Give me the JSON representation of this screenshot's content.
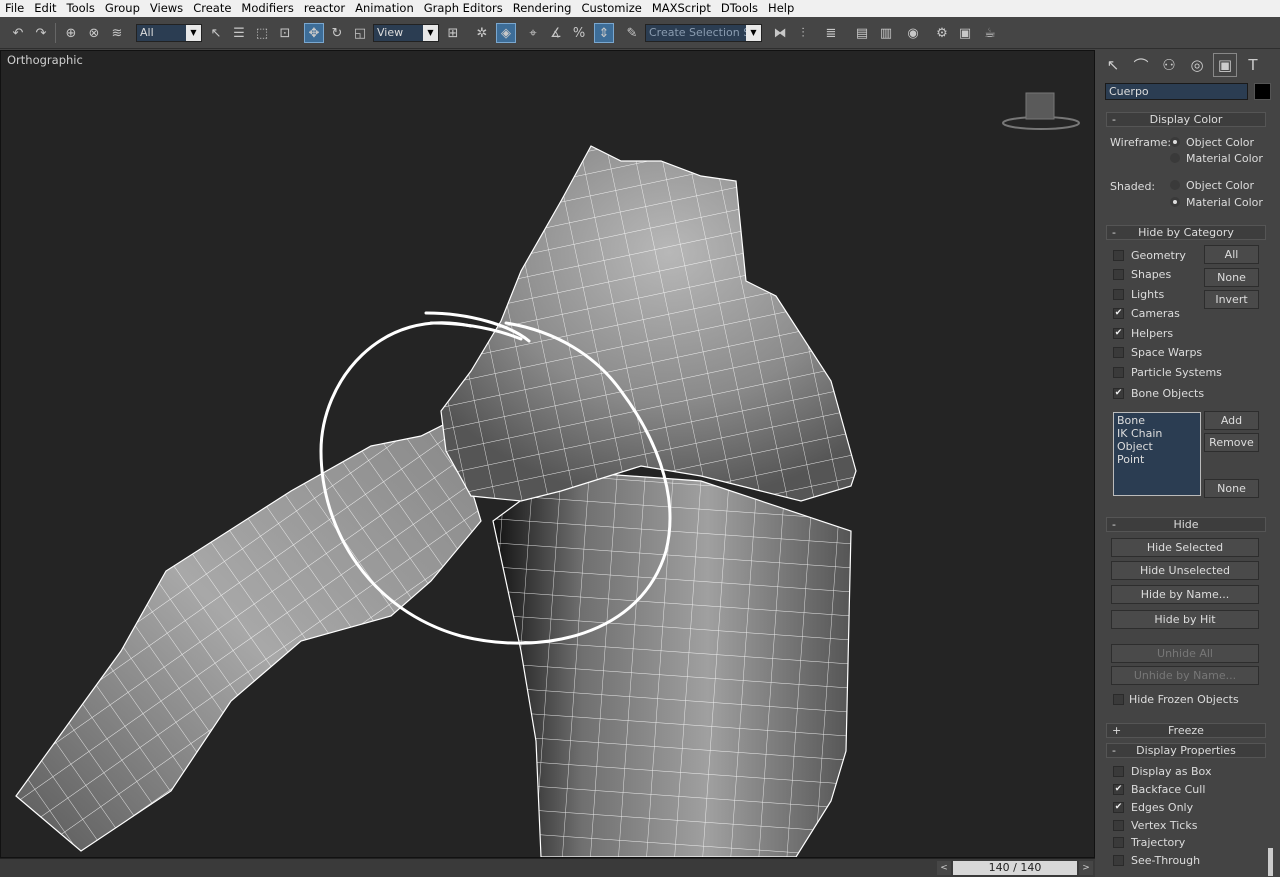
{
  "menu": [
    "File",
    "Edit",
    "Tools",
    "Group",
    "Views",
    "Create",
    "Modifiers",
    "reactor",
    "Animation",
    "Graph Editors",
    "Rendering",
    "Customize",
    "MAXScript",
    "DTools",
    "Help"
  ],
  "toolbar": {
    "filter_value": "All",
    "refcoord_value": "View",
    "named_selection_placeholder": "Create Selection Se"
  },
  "viewport": {
    "label": "Orthographic"
  },
  "timeslider": {
    "frame_text": "140 / 140"
  },
  "object": {
    "name": "Cuerpo",
    "color": "#000000"
  },
  "display_color": {
    "title": "Display Color",
    "wireframe_label": "Wireframe:",
    "shaded_label": "Shaded:",
    "object_color": "Object Color",
    "material_color": "Material Color"
  },
  "hide_by_category": {
    "title": "Hide by Category",
    "items": [
      {
        "label": "Geometry",
        "checked": false
      },
      {
        "label": "Shapes",
        "checked": false
      },
      {
        "label": "Lights",
        "checked": false
      },
      {
        "label": "Cameras",
        "checked": true
      },
      {
        "label": "Helpers",
        "checked": true
      },
      {
        "label": "Space Warps",
        "checked": false
      },
      {
        "label": "Particle Systems",
        "checked": false
      },
      {
        "label": "Bone Objects",
        "checked": true
      }
    ],
    "all_button": "All",
    "none_button": "None",
    "invert_button": "Invert",
    "list_items": [
      "Bone",
      "IK Chain Object",
      "Point"
    ],
    "add_button": "Add",
    "remove_button": "Remove",
    "list_none_button": "None"
  },
  "hide": {
    "title": "Hide",
    "hide_selected": "Hide Selected",
    "hide_unselected": "Hide Unselected",
    "hide_by_name": "Hide by Name...",
    "hide_by_hit": "Hide by Hit",
    "unhide_all": "Unhide All",
    "unhide_by_name": "Unhide by Name...",
    "hide_frozen": "Hide Frozen Objects"
  },
  "freeze": {
    "title": "Freeze"
  },
  "display_properties": {
    "title": "Display Properties",
    "items": [
      {
        "label": "Display as Box",
        "checked": false
      },
      {
        "label": "Backface Cull",
        "checked": true
      },
      {
        "label": "Edges Only",
        "checked": true
      },
      {
        "label": "Vertex Ticks",
        "checked": false
      },
      {
        "label": "Trajectory",
        "checked": false
      },
      {
        "label": "See-Through",
        "checked": false
      }
    ]
  }
}
